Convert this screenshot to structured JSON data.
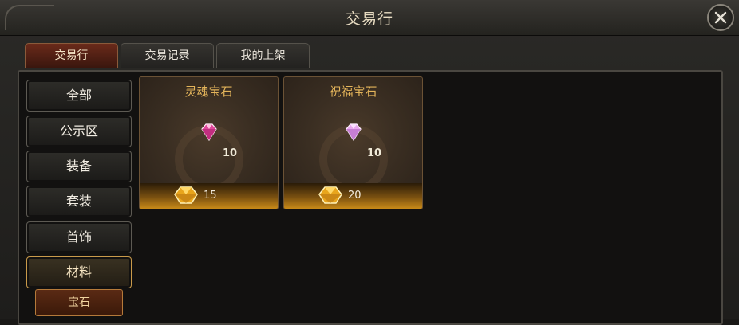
{
  "window": {
    "title": "交易行"
  },
  "tabs": [
    {
      "label": "交易行",
      "active": true
    },
    {
      "label": "交易记录",
      "active": false
    },
    {
      "label": "我的上架",
      "active": false
    }
  ],
  "categories": [
    {
      "label": "全部"
    },
    {
      "label": "公示区"
    },
    {
      "label": "装备"
    },
    {
      "label": "套装"
    },
    {
      "label": "首饰"
    },
    {
      "label": "材料",
      "active": true
    }
  ],
  "subcategory": {
    "label": "宝石"
  },
  "items": [
    {
      "name": "灵魂宝石",
      "quantity": "10",
      "price": "15",
      "gem_color": "#e0479a"
    },
    {
      "name": "祝福宝石",
      "quantity": "10",
      "price": "20",
      "gem_color": "#e9a8ee"
    }
  ],
  "colors": {
    "accent_gold": "#e3b45a",
    "active_tab": "#6a2a1a"
  }
}
